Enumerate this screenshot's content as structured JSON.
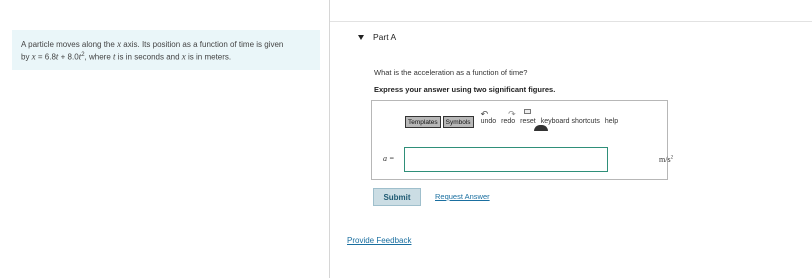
{
  "problem": {
    "line1_prefix": "A particle moves along the ",
    "axis_var": "x",
    "line1_suffix": " axis. Its position as a function of time is given",
    "line2_prefix": "by ",
    "eq_x": "x",
    "eq_mid": " = 6.8",
    "eq_t1": "t",
    "eq_mid2": " + 8.0",
    "eq_t2": "t",
    "eq_exp": "2",
    "eq_after": ", where ",
    "t_var": "t",
    "t_desc": " is in seconds and ",
    "x_var": "x",
    "x_desc": " is in meters."
  },
  "part": {
    "label": "Part A"
  },
  "question": "What is the acceleration as a function of time?",
  "instruction": "Express your answer using two significant figures.",
  "toolbar": {
    "templates": "Templates",
    "symbols": "Symbols",
    "undo": "undo",
    "redo": "redo",
    "reset": "reset",
    "shortcuts": "keyboard shortcuts",
    "help": "help"
  },
  "answer": {
    "variable": "a =",
    "value": "",
    "unit_base": "m/s",
    "unit_exp": "2"
  },
  "actions": {
    "submit": "Submit",
    "request": "Request Answer",
    "feedback": "Provide Feedback"
  }
}
